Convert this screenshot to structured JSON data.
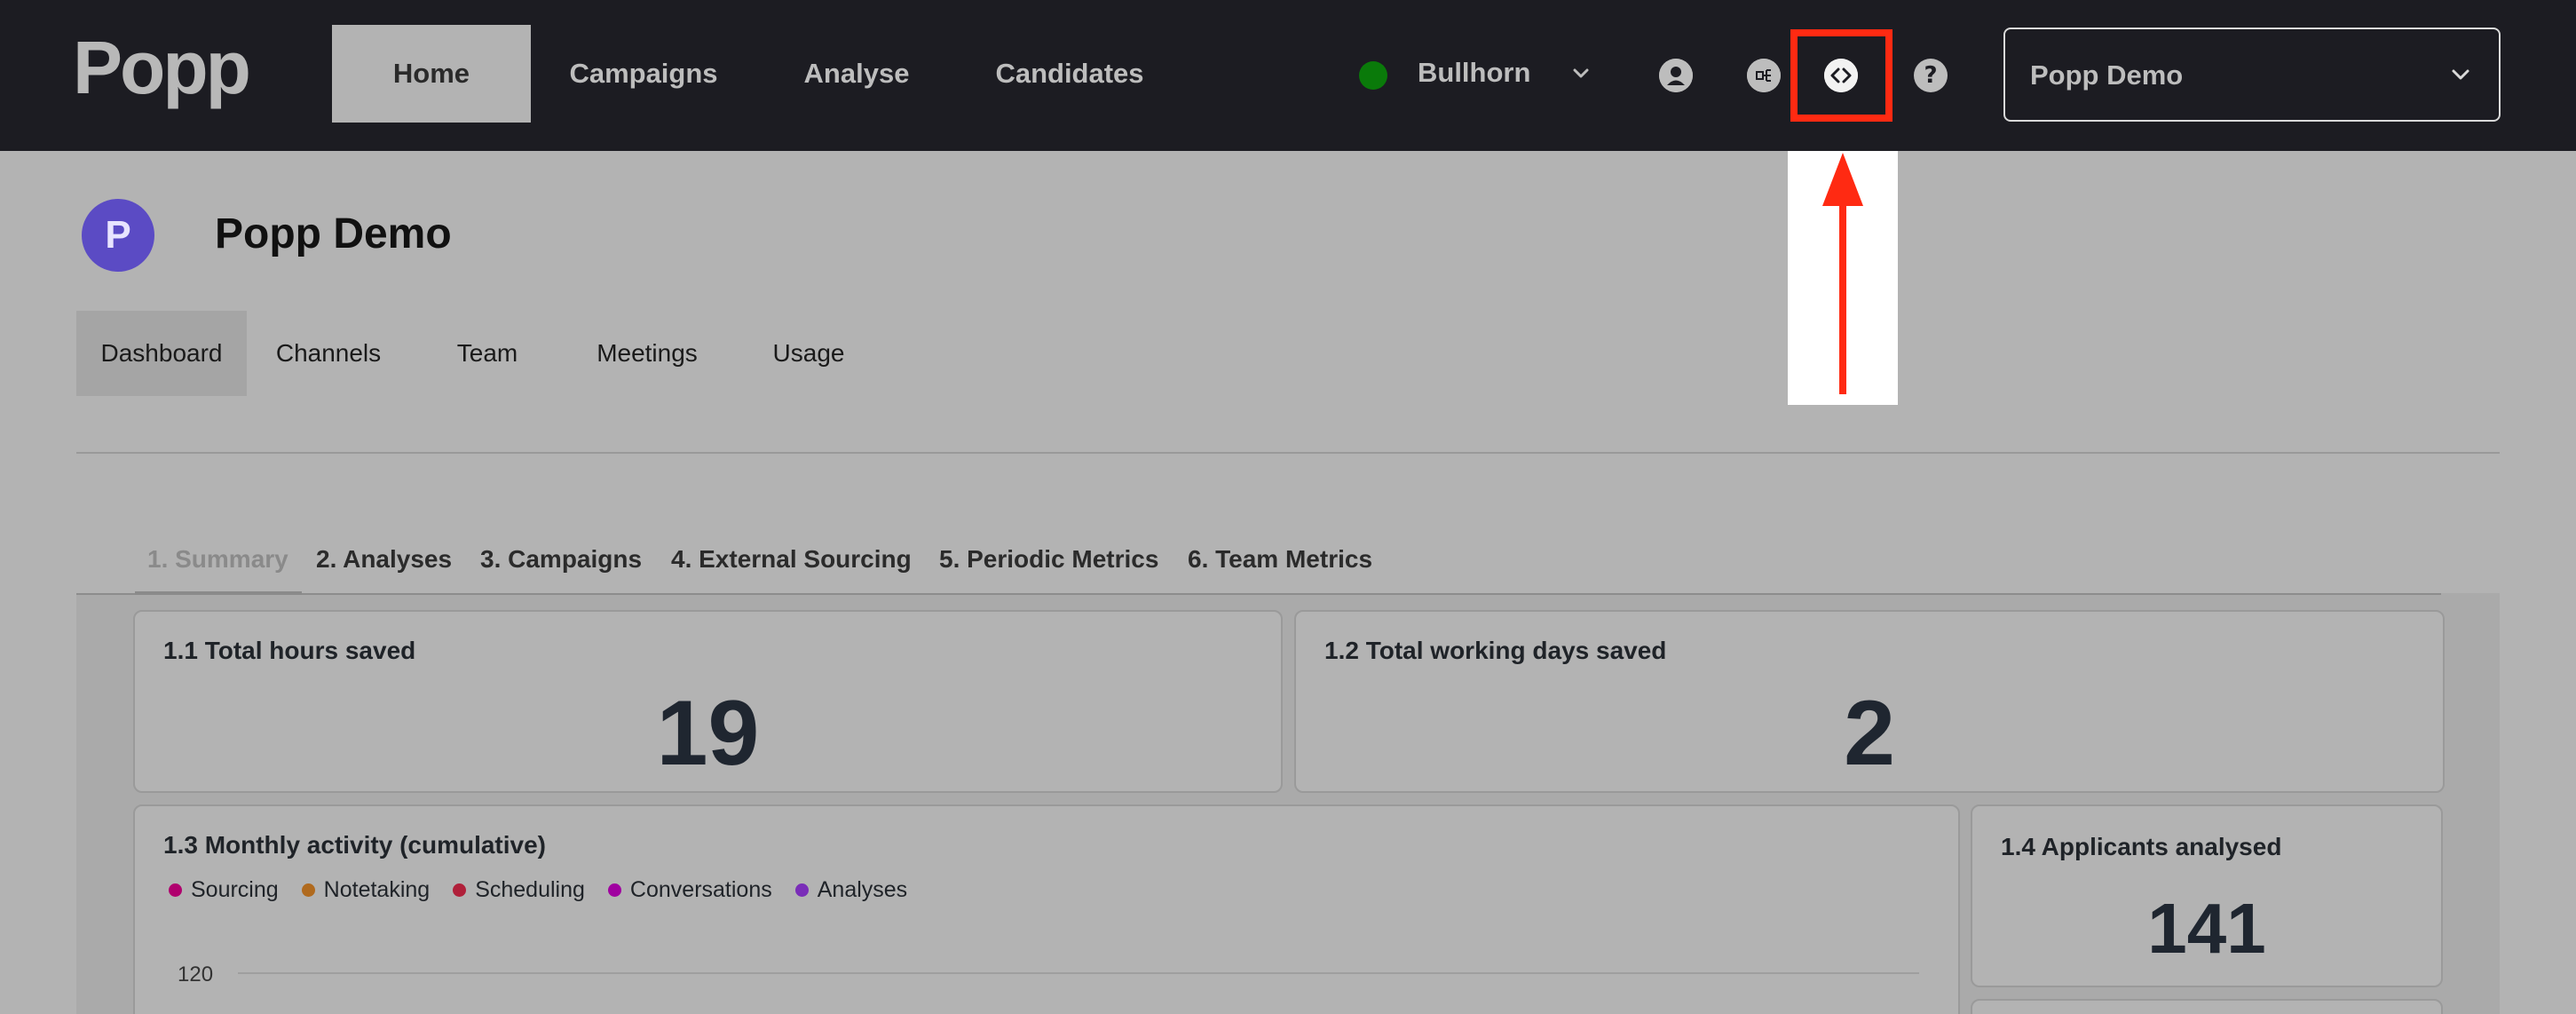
{
  "brand": {
    "logo": "Popp"
  },
  "nav": {
    "home": "Home",
    "campaigns": "Campaigns",
    "analyse": "Analyse",
    "candidates": "Candidates"
  },
  "crm": {
    "label": "Bullhorn",
    "status_color": "#0a7a0a"
  },
  "account": {
    "name": "Popp Demo"
  },
  "org": {
    "avatar_letter": "P",
    "title": "Popp Demo",
    "avatar_color": "#5b4bc4"
  },
  "subtabs": {
    "dashboard": "Dashboard",
    "channels": "Channels",
    "team": "Team",
    "meetings": "Meetings",
    "usage": "Usage"
  },
  "section_tabs": [
    "1. Summary",
    "2. Analyses",
    "3. Campaigns",
    "4. External Sourcing",
    "5. Periodic Metrics",
    "6. Team Metrics"
  ],
  "cards": {
    "hours": {
      "title": "1.1 Total hours saved",
      "value": "19"
    },
    "days": {
      "title": "1.2 Total working days saved",
      "value": "2"
    },
    "monthly": {
      "title": "1.3 Monthly activity (cumulative)",
      "legend": [
        {
          "label": "Sourcing",
          "color": "#b0006e"
        },
        {
          "label": "Notetaking",
          "color": "#b06a1e"
        },
        {
          "label": "Scheduling",
          "color": "#b0203a"
        },
        {
          "label": "Conversations",
          "color": "#a000a0"
        },
        {
          "label": "Analyses",
          "color": "#7a2db8"
        }
      ],
      "y_tick": "120"
    },
    "applicants": {
      "title": "1.4 Applicants analysed",
      "value": "141"
    }
  },
  "annotation": {
    "highlight_color": "#ff2a12",
    "target_icon": "code-icon"
  }
}
